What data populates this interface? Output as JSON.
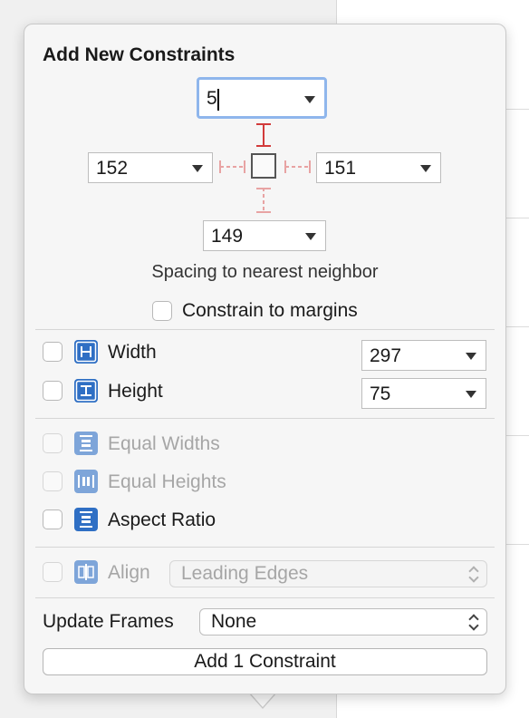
{
  "popover": {
    "title": "Add New Constraints",
    "spacing": {
      "top": "5",
      "left": "152",
      "right": "151",
      "bottom": "149"
    },
    "spacing_caption": "Spacing to nearest neighbor",
    "constrain_to_margins": {
      "label": "Constrain to margins",
      "checked": false
    },
    "size": [
      {
        "label": "Width",
        "value": "297",
        "checked": false,
        "icon": "width-icon"
      },
      {
        "label": "Height",
        "value": "75",
        "checked": false,
        "icon": "height-icon"
      }
    ],
    "equal": [
      {
        "label": "Equal Widths",
        "enabled": false,
        "icon": "equal-widths-icon"
      },
      {
        "label": "Equal Heights",
        "enabled": false,
        "icon": "equal-heights-icon"
      },
      {
        "label": "Aspect Ratio",
        "enabled": true,
        "icon": "aspect-ratio-icon"
      }
    ],
    "align": {
      "label": "Align",
      "value": "Leading Edges",
      "enabled": false,
      "icon": "align-icon"
    },
    "update_frames": {
      "label": "Update Frames",
      "value": "None"
    },
    "add_button": "Add 1 Constraint"
  },
  "colors": {
    "accent": "#2f6fc4",
    "active_strut": "#d23b3b",
    "inactive_strut": "#e8a3a3",
    "focus_ring": "#8fb6ec"
  }
}
